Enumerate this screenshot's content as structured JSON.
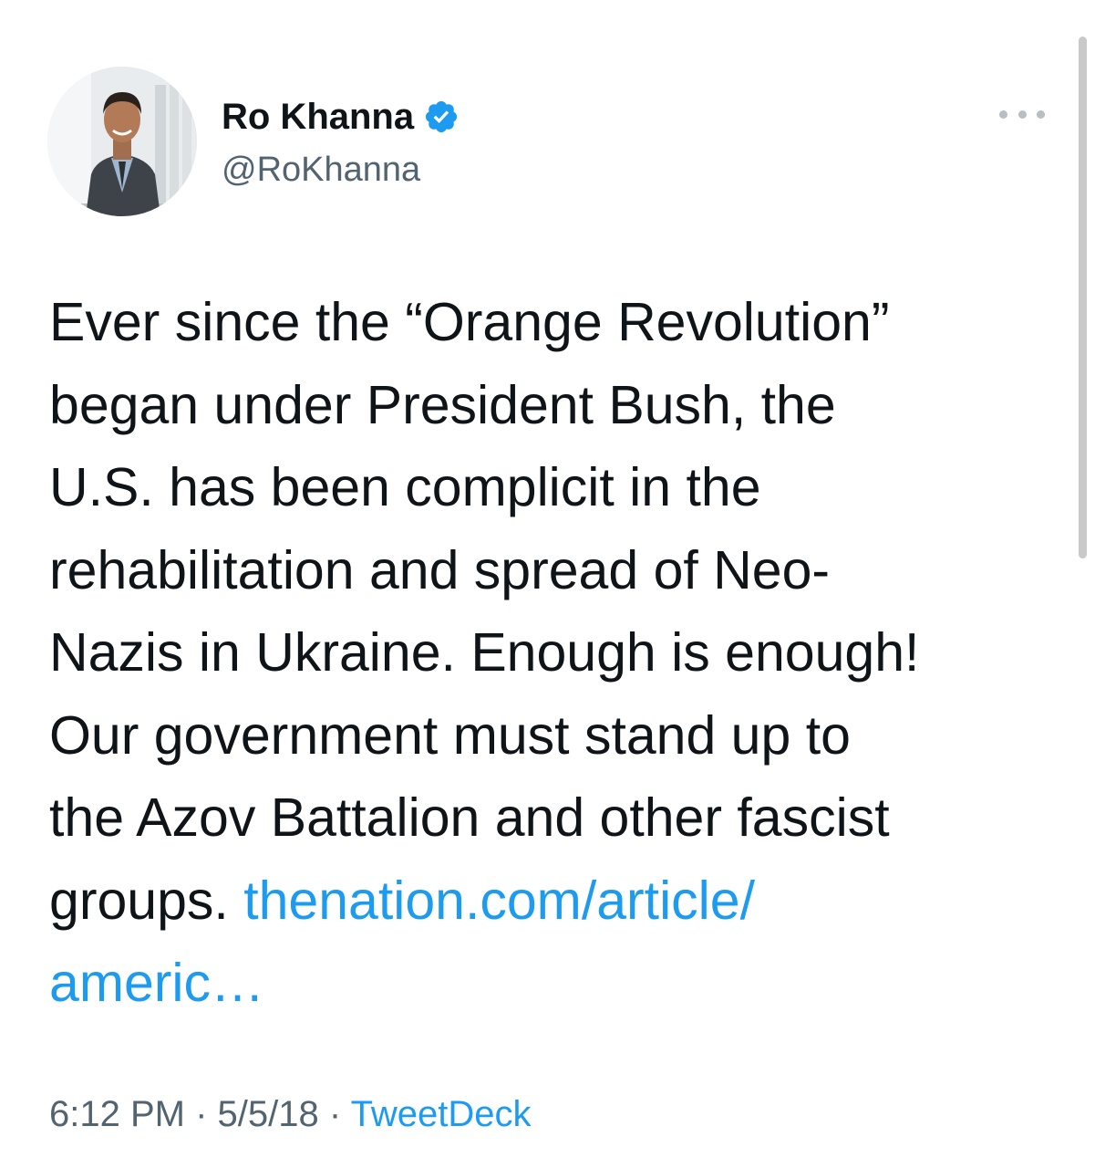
{
  "tweet": {
    "author": {
      "display_name": "Ro Khanna",
      "handle": "@RoKhanna",
      "verified": true,
      "avatar_icon": "profile-photo"
    },
    "text_lines": [
      "Ever since the “Orange Revolution”",
      "began under President Bush, the",
      "U.S. has been complicit in the",
      "rehabilitation and spread of Neo-",
      "Nazis in Ukraine. Enough is enough!",
      "Our government must stand up to",
      "the Azov Battalion and other fascist"
    ],
    "last_line_text": "groups.",
    "link_part1": "thenation.com/article/",
    "link_part2": "americ…",
    "time": "6:12 PM",
    "date": "5/5/18",
    "separator": "·",
    "source": "TweetDeck"
  },
  "colors": {
    "text": "#0f1419",
    "secondary": "#536471",
    "link": "#1d9bf0",
    "verified": "#1d9bf0"
  }
}
